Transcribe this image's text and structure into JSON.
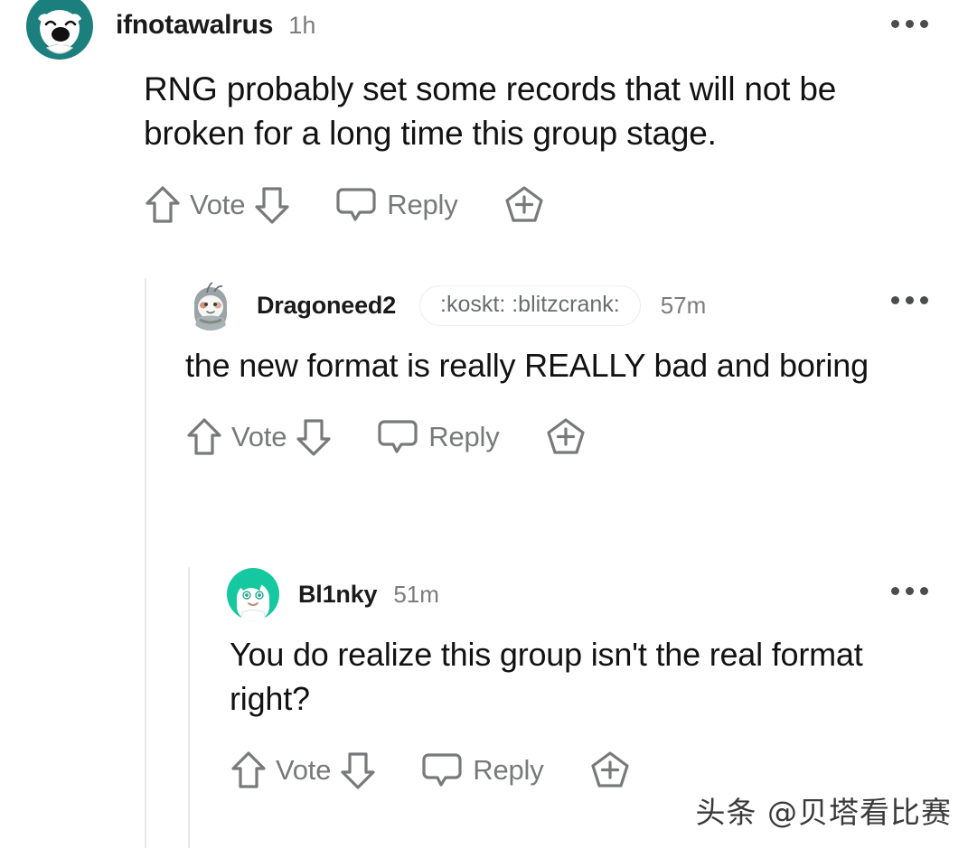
{
  "thread": {
    "comments": [
      {
        "id": "comment-root",
        "depth": 0,
        "username": "ifnotawalrus",
        "timestamp": "1h",
        "flair": null,
        "body": "RNG probably set some records that will not be broken for a long time this group stage.",
        "avatar": {
          "name": "avatar-ifnotawalrus",
          "style": "bear-teal",
          "colors": {
            "ring": "#1b7f7d",
            "face": "#ffffff",
            "feature": "#111111"
          }
        },
        "actions": {
          "vote_label": "Vote",
          "reply_label": "Reply",
          "upvote_icon": "upvote-arrow-icon",
          "downvote_icon": "downvote-arrow-icon",
          "reply_icon": "speech-bubble-icon",
          "award_icon": "award-plus-pentagon-icon"
        },
        "overflow_icon": "more-options-icon"
      },
      {
        "id": "comment-reply-1",
        "depth": 1,
        "username": "Dragoneed2",
        "timestamp": "57m",
        "flair": ":koskt: :blitzcrank:",
        "body": "the new format is really REALLY bad and boring",
        "avatar": {
          "name": "avatar-dragoneed2",
          "style": "snoo-grey",
          "colors": {
            "ring": "#9aa3a8",
            "face": "#f6f6f4",
            "feature": "#6a6f72"
          }
        },
        "actions": {
          "vote_label": "Vote",
          "reply_label": "Reply",
          "upvote_icon": "upvote-arrow-icon",
          "downvote_icon": "downvote-arrow-icon",
          "reply_icon": "speech-bubble-icon",
          "award_icon": "award-plus-pentagon-icon"
        },
        "overflow_icon": "more-options-icon"
      },
      {
        "id": "comment-reply-2",
        "depth": 2,
        "username": "Bl1nky",
        "timestamp": "51m",
        "flair": null,
        "body": "You do realize this group isn't the real format right?",
        "avatar": {
          "name": "avatar-bl1nky",
          "style": "snoo-teal",
          "colors": {
            "ring": "#15c8a0",
            "face": "#ffffff",
            "feature": "#2aa98c"
          }
        },
        "actions": {
          "vote_label": "Vote",
          "reply_label": "Reply",
          "upvote_icon": "upvote-arrow-icon",
          "downvote_icon": "downvote-arrow-icon",
          "reply_icon": "speech-bubble-icon",
          "award_icon": "award-plus-pentagon-icon"
        },
        "overflow_icon": "more-options-icon"
      }
    ]
  },
  "watermark": {
    "text": "头条 @贝塔看比赛"
  },
  "colors": {
    "background": "#ffffff",
    "body_text": "#121212",
    "muted_text": "#77797a",
    "thread_line": "#e6e7e8",
    "flair_border": "#ededee"
  }
}
